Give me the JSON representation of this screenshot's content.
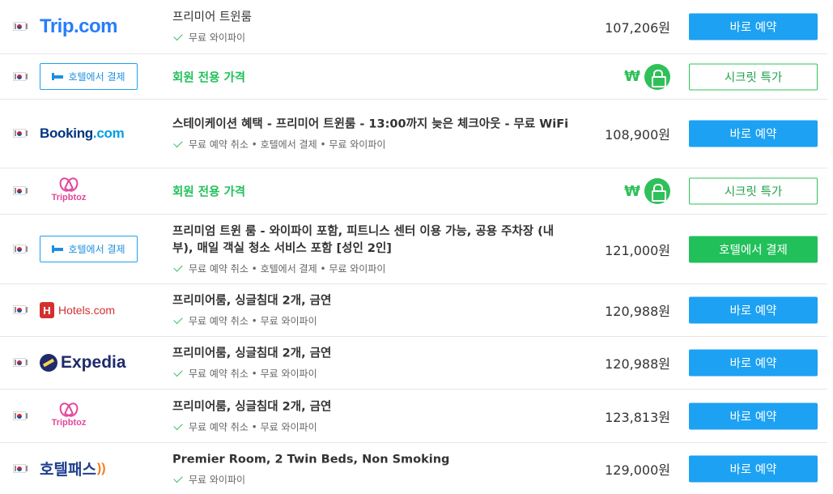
{
  "rows": [
    {
      "provider": "Trip.com",
      "title": "프리미어 트윈룸",
      "features": "무료 와이파이",
      "price": "107,206원",
      "action": "바로 예약"
    },
    {
      "provider_button": "호텔에서 결제",
      "member_label": "회원 전용 가격",
      "currency_symbol": "₩",
      "action": "시크릿 특가"
    },
    {
      "provider": "Booking.com",
      "title": "스테이케이션 혜택 - 프리미어 트윈룸 - 13:00까지 늦은 체크아웃 - 무료 WiFi",
      "features": "무료 예약 취소 • 호텔에서 결제 • 무료 와이파이",
      "price": "108,900원",
      "action": "바로 예약"
    },
    {
      "provider": "Tripbtoz",
      "member_label": "회원 전용 가격",
      "currency_symbol": "₩",
      "action": "시크릿 특가"
    },
    {
      "provider_button": "호텔에서 결제",
      "title": "프리미엄 트윈 룸 - 와이파이 포함, 피트니스 센터 이용 가능, 공용 주차장 (내부), 매일 객실 청소 서비스 포함 [성인 2인]",
      "features": "무료 예약 취소 • 호텔에서 결제 • 무료 와이파이",
      "price": "121,000원",
      "action": "호텔에서 결제"
    },
    {
      "provider": "Hotels.com",
      "title": "프리미어룸, 싱글침대 2개, 금연",
      "features": "무료 예약 취소 • 무료 와이파이",
      "price": "120,988원",
      "action": "바로 예약"
    },
    {
      "provider": "Expedia",
      "title": "프리미어룸, 싱글침대 2개, 금연",
      "features": "무료 예약 취소 • 무료 와이파이",
      "price": "120,988원",
      "action": "바로 예약"
    },
    {
      "provider": "Tripbtoz",
      "title": "프리미어룸, 싱글침대 2개, 금연",
      "features": "무료 예약 취소 • 무료 와이파이",
      "price": "123,813원",
      "action": "바로 예약"
    },
    {
      "provider": "호텔패스",
      "title": "Premier Room, 2 Twin Beds, Non Smoking",
      "features": "무료 와이파이",
      "price": "129,000원",
      "action": "바로 예약"
    }
  ],
  "colors": {
    "primary_blue": "#1da1f2",
    "member_green": "#21c05a"
  },
  "icons": {
    "flag": "south-korea-flag-icon",
    "check": "check-icon",
    "lock": "lock-icon",
    "bed": "bed-icon"
  }
}
